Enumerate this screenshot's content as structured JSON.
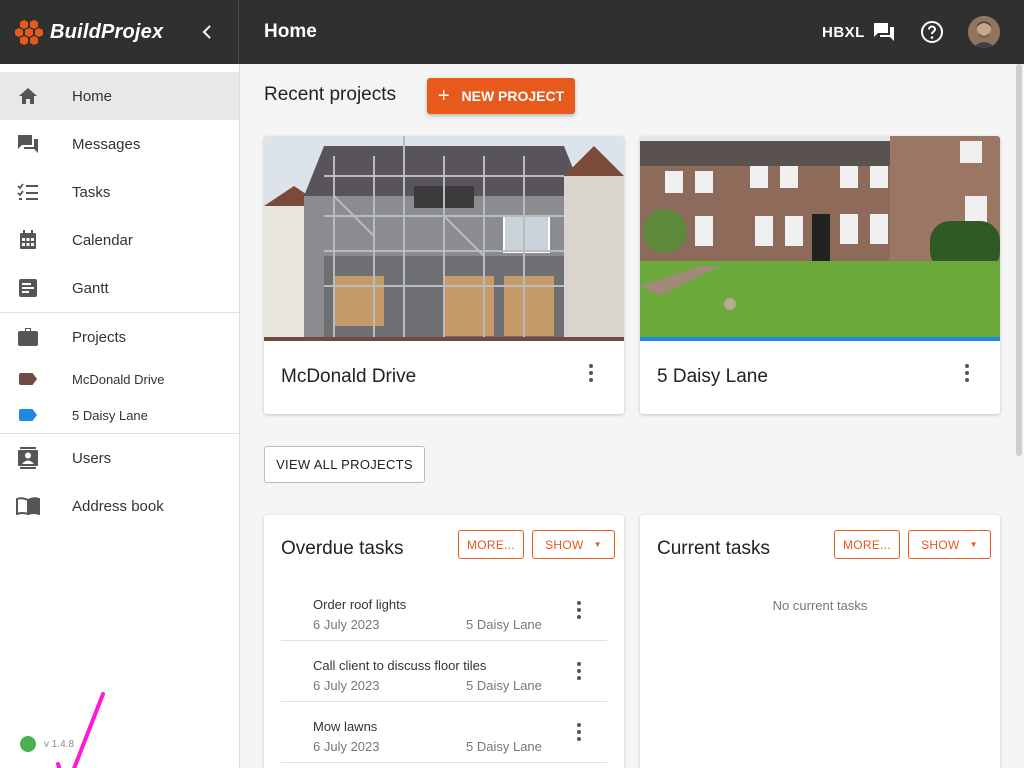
{
  "app": {
    "name": "BuildProjex",
    "page_title": "Home",
    "org_code": "HBXL",
    "version": "v 1.4.8"
  },
  "icons": {
    "logo": "hexagon-logo-icon",
    "collapse": "chevron-left-icon",
    "messages": "chat-icon",
    "help": "help-circle-icon",
    "status": "status-dot"
  },
  "colors": {
    "accent": "#e85a1c",
    "topbar": "#303030",
    "status_ok": "#4caf50",
    "annotation": "#ff19d9"
  },
  "sidebar": {
    "items": [
      {
        "label": "Home",
        "icon": "home-icon"
      },
      {
        "label": "Messages",
        "icon": "messages-icon"
      },
      {
        "label": "Tasks",
        "icon": "tasks-icon"
      },
      {
        "label": "Calendar",
        "icon": "calendar-icon"
      },
      {
        "label": "Gantt",
        "icon": "gantt-icon"
      },
      {
        "label": "Projects",
        "icon": "briefcase-icon"
      },
      {
        "label": "McDonald Drive",
        "icon": "tag-icon",
        "color": "#6d4c41"
      },
      {
        "label": "5 Daisy Lane",
        "icon": "tag-icon",
        "color": "#1e88e5"
      },
      {
        "label": "Users",
        "icon": "contacts-icon"
      },
      {
        "label": "Address book",
        "icon": "book-icon"
      }
    ]
  },
  "recent": {
    "title": "Recent projects",
    "new_button": "NEW PROJECT",
    "view_all": "VIEW ALL PROJECTS",
    "projects": [
      {
        "name": "McDonald Drive",
        "color": "#6d4c41"
      },
      {
        "name": "5 Daisy Lane",
        "color": "#1e88e5"
      }
    ]
  },
  "overdue": {
    "title": "Overdue tasks",
    "more": "MORE...",
    "show": "SHOW",
    "tasks": [
      {
        "name": "Order roof lights",
        "date": "6 July 2023",
        "project": "5 Daisy Lane"
      },
      {
        "name": "Call client to discuss floor tiles",
        "date": "6 July 2023",
        "project": "5 Daisy Lane"
      },
      {
        "name": "Mow lawns",
        "date": "6 July 2023",
        "project": "5 Daisy Lane"
      }
    ]
  },
  "current": {
    "title": "Current tasks",
    "more": "MORE...",
    "show": "SHOW",
    "empty": "No current tasks"
  }
}
